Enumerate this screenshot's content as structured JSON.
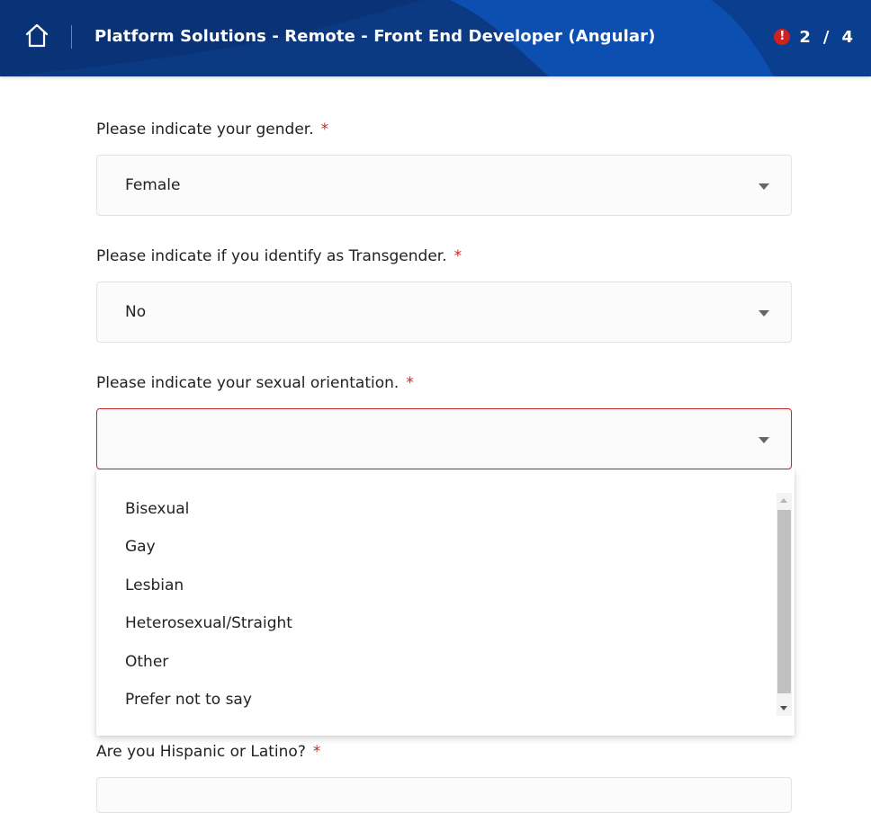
{
  "header": {
    "title": "Platform Solutions - Remote - Front End Developer (Angular)",
    "home_icon": "home-icon",
    "alert_icon": "exclamation-icon",
    "alert_symbol": "!",
    "progress": {
      "current": "2",
      "separator": "/",
      "total": "4"
    },
    "colors": {
      "primary": "#0b3a82",
      "accent": "#0d4fb0",
      "alert": "#d0201f"
    }
  },
  "form": {
    "questions": [
      {
        "label": "Please indicate your gender.",
        "required": "*",
        "value": "Female"
      },
      {
        "label": "Please indicate if you identify as Transgender.",
        "required": "*",
        "value": "No"
      },
      {
        "label": "Please indicate your sexual orientation.",
        "required": "*",
        "value": ""
      },
      {
        "label": "Are you Hispanic or Latino?",
        "required": "*"
      }
    ],
    "dropdown_options": [
      "Bisexual",
      "Gay",
      "Lesbian",
      "Heterosexual/Straight",
      "Other",
      "Prefer not to say"
    ],
    "error_color": "#c62828"
  }
}
